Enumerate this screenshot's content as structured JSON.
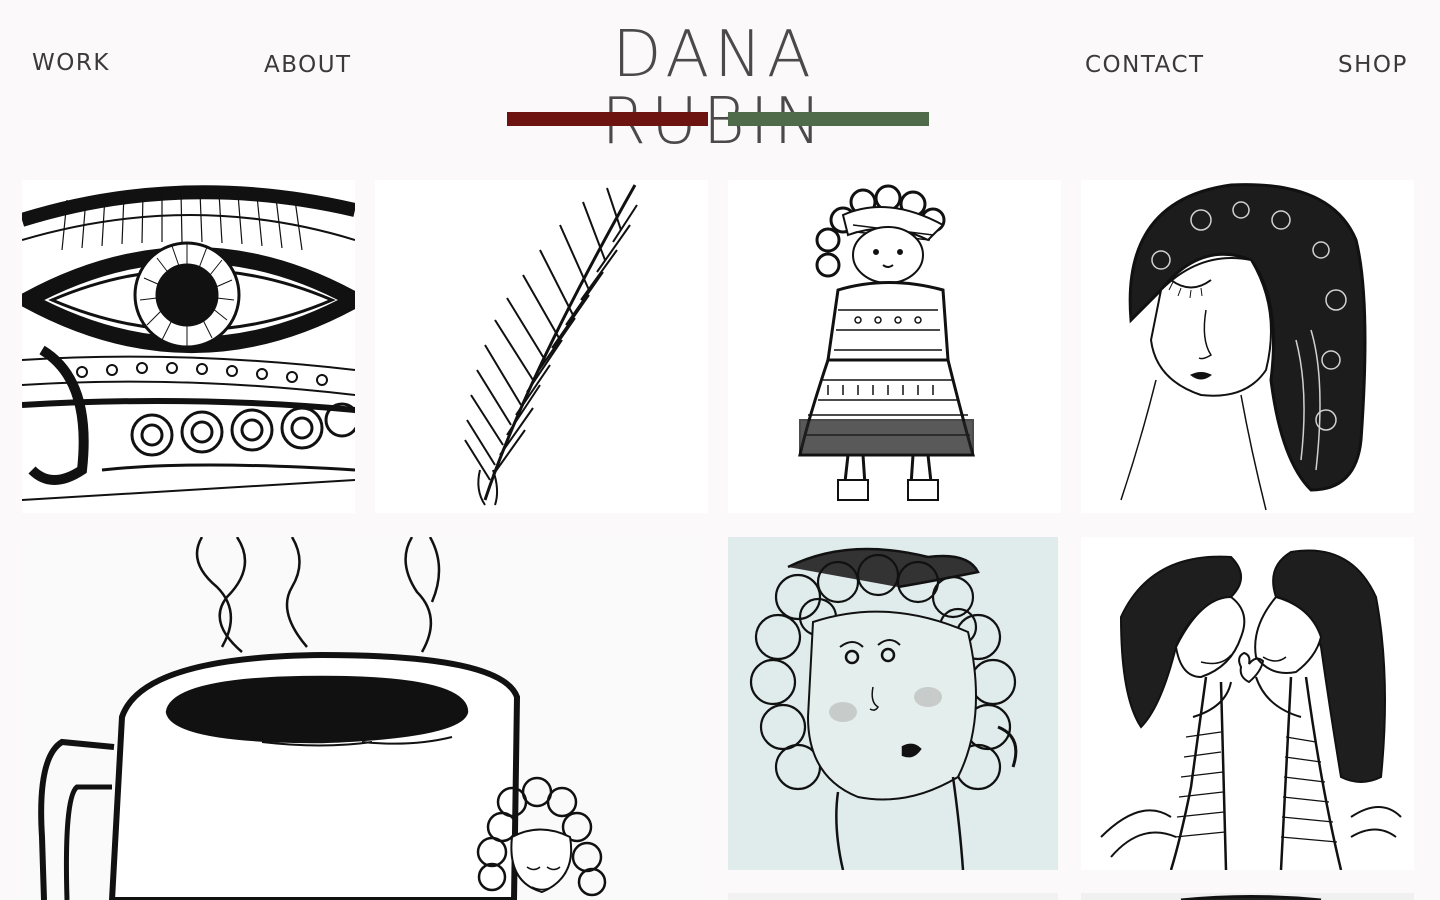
{
  "site": {
    "title": "DANA RUBIN"
  },
  "nav": {
    "work": "WORK",
    "about": "ABOUT",
    "contact": "CONTACT",
    "shop": "SHOP"
  },
  "brand_colors": {
    "bar_left": "#6e1410",
    "bar_right": "#4f6b4a"
  },
  "gallery": {
    "items": [
      {
        "icon": "zentangle-eye-drawing"
      },
      {
        "icon": "feather-drawing"
      },
      {
        "icon": "girl-in-patterned-dress-drawing"
      },
      {
        "icon": "woman-with-patterned-hair-drawing"
      },
      {
        "icon": "coffee-mug-drawing"
      },
      {
        "icon": "curly-haired-woman-drawing"
      },
      {
        "icon": "two-faces-with-heart-drawing"
      },
      {
        "icon": "partial-artwork"
      },
      {
        "icon": "partial-artwork"
      }
    ]
  }
}
